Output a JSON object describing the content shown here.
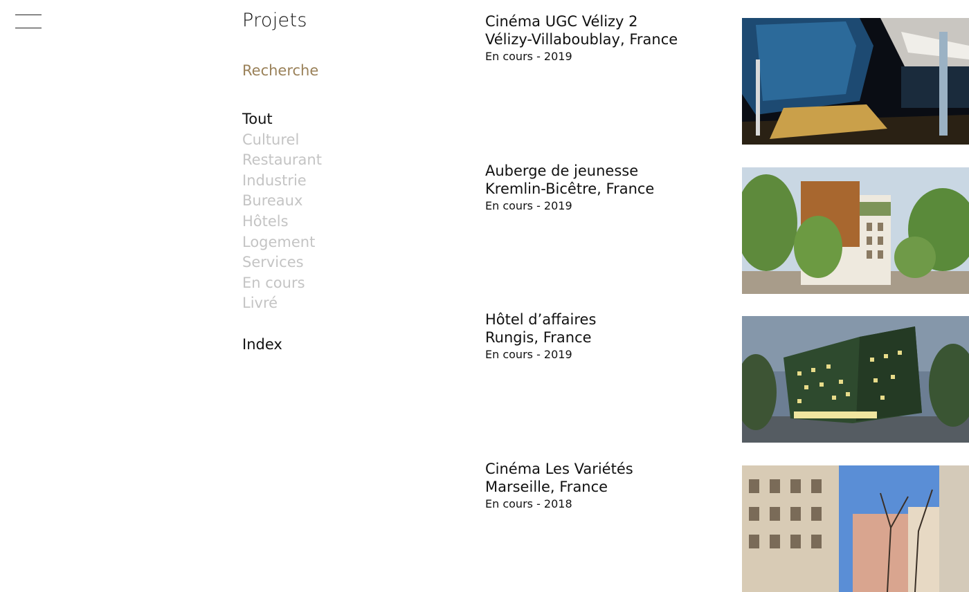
{
  "header": {
    "menu_icon": "hamburger-icon",
    "title": "Projets"
  },
  "sidebar": {
    "search_label": "Recherche",
    "filters": [
      {
        "label": "Tout",
        "active": true
      },
      {
        "label": "Culturel",
        "active": false
      },
      {
        "label": "Restaurant",
        "active": false
      },
      {
        "label": "Industrie",
        "active": false
      },
      {
        "label": "Bureaux",
        "active": false
      },
      {
        "label": "Hôtels",
        "active": false
      },
      {
        "label": "Logement",
        "active": false
      },
      {
        "label": "Services",
        "active": false
      },
      {
        "label": "En cours",
        "active": false
      },
      {
        "label": "Livré",
        "active": false
      }
    ],
    "index_label": "Index"
  },
  "colors": {
    "accent": "#9a8159",
    "inactive_filter": "#c4c4c4",
    "text": "#111111"
  },
  "projects": [
    {
      "title": "Cinéma UGC Vélizy 2",
      "location": "Vélizy-Villaboublay, France",
      "status": "En cours - 2019",
      "image": "cinema-interior-render"
    },
    {
      "title": "Auberge de jeunesse",
      "location": "Kremlin-Bicêtre, France",
      "status": "En cours - 2019",
      "image": "hostel-building-render"
    },
    {
      "title": "Hôtel d’affaires",
      "location": "Rungis, France",
      "status": "En cours - 2019",
      "image": "hotel-night-render"
    },
    {
      "title": "Cinéma Les Variétés",
      "location": "Marseille, France",
      "status": "En cours - 2018",
      "image": "street-facade-photo"
    }
  ]
}
